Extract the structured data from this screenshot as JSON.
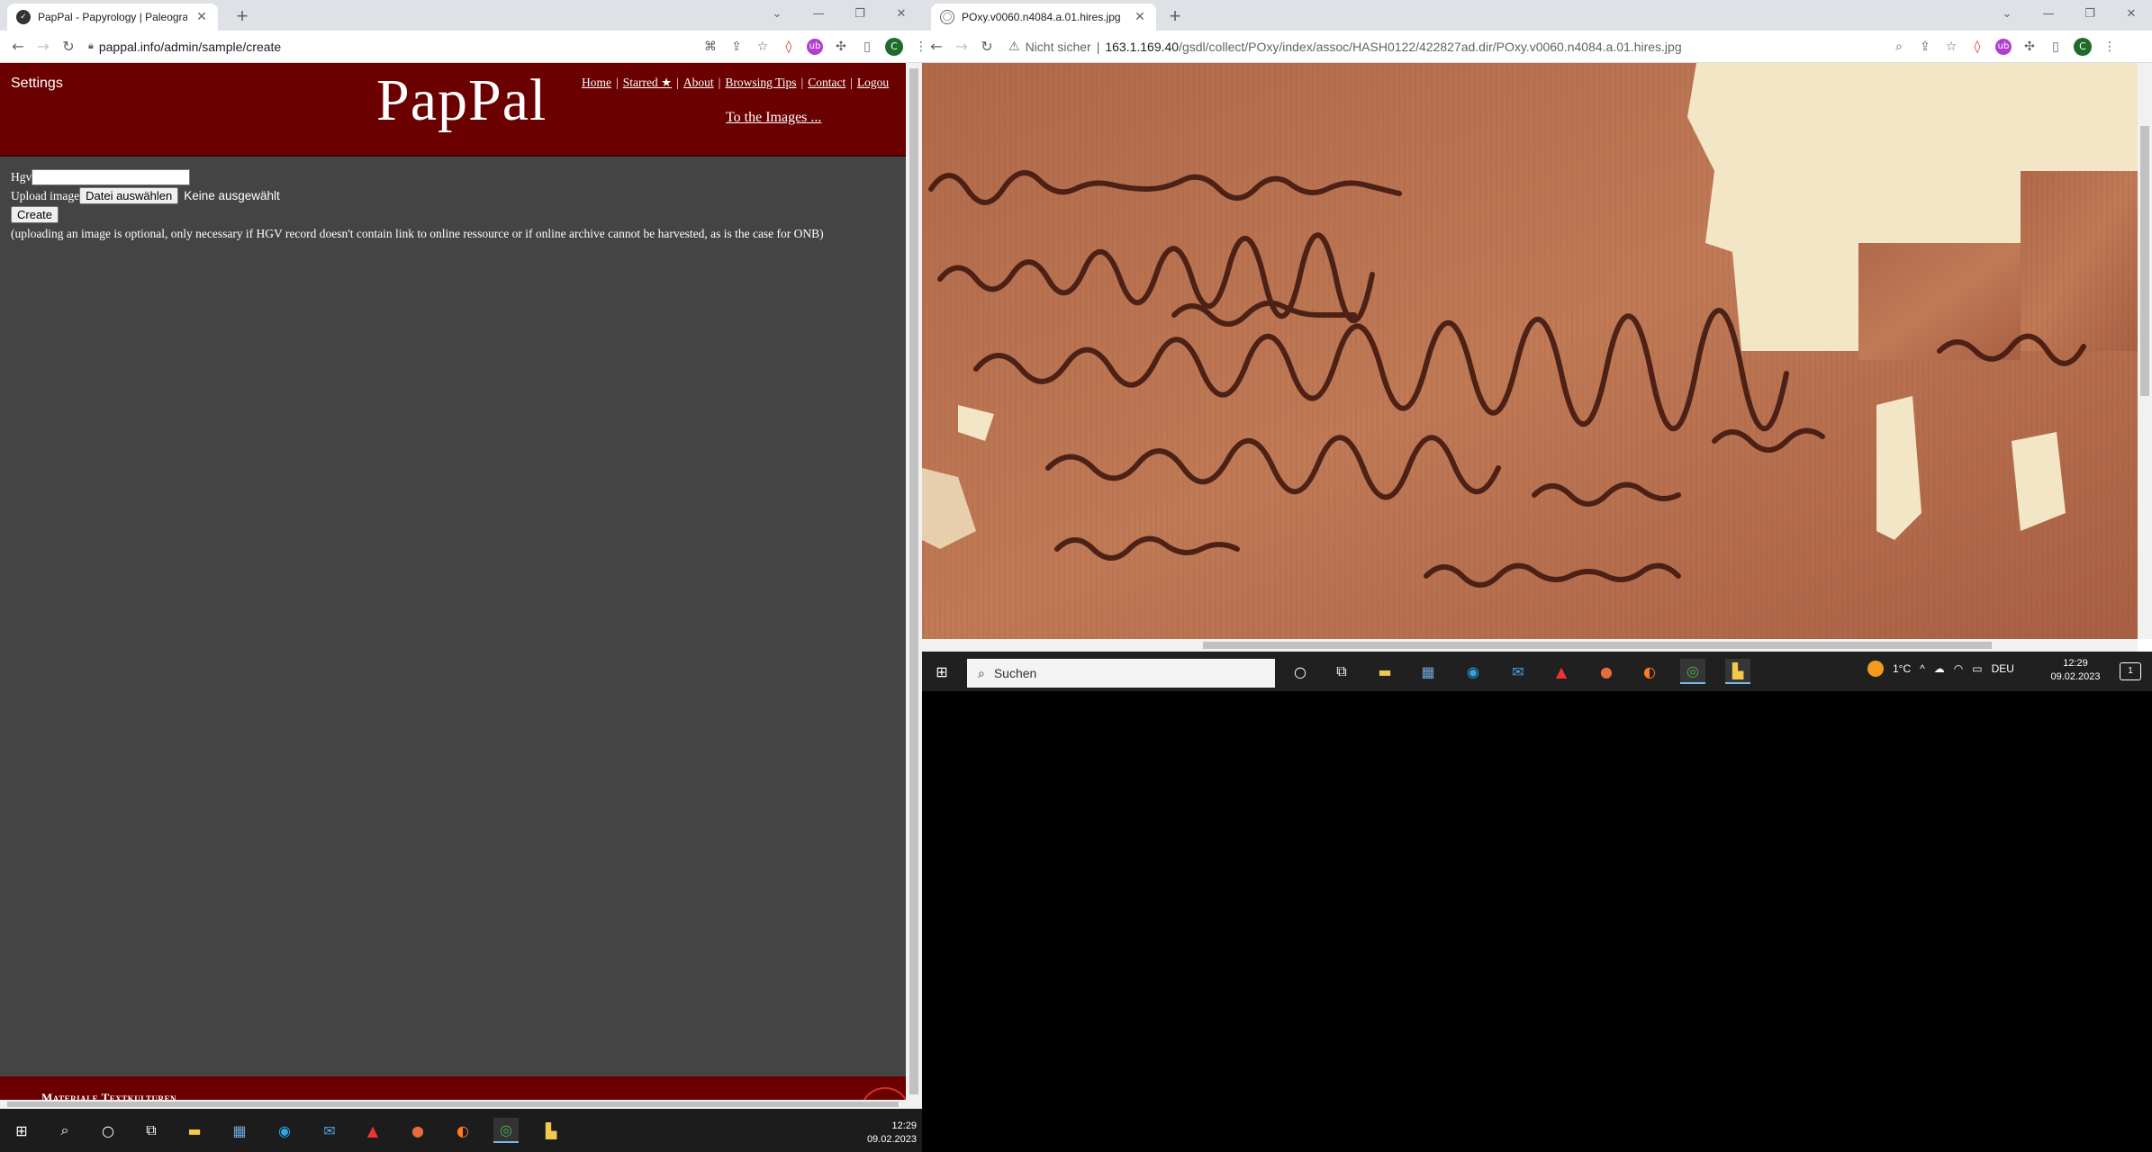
{
  "left_window": {
    "tab_title": "PapPal - Papyrology | Paleograph",
    "url": "pappal.info/admin/sample/create",
    "page": {
      "settings": "Settings",
      "logo": "PapPal",
      "nav": [
        "Home",
        "Starred ★",
        "About",
        "Browsing Tips",
        "Contact",
        "Logou"
      ],
      "to_images": "To the Images ...",
      "form": {
        "hgv_label": "Hgv",
        "hgv_value": "",
        "upload_label": "Upload image",
        "file_button": "Datei auswählen",
        "no_file": "Keine ausgewählt",
        "create_button": "Create",
        "note": "(uploading an image is optional, only necessary if HGV record doesn't contain link to online ressource or if online archive cannot be harvested, as is the case for ONB)"
      },
      "footer_text": "Materiale Textkulturen"
    },
    "taskbar": {
      "time": "12:29",
      "date": "09.02.2023"
    }
  },
  "right_window": {
    "tab_title": "POxy.v0060.n4084.a.01.hires.jpg",
    "security": "Nicht sicher",
    "url_host": "163.1.169.40",
    "url_path": "/gsdl/collect/POxy/index/assoc/HASH0122/422827ad.dir/POxy.v0060.n4084.a.01.hires.jpg",
    "taskbar": {
      "search_placeholder": "Suchen",
      "temperature": "1°C",
      "language": "DEU",
      "time": "12:29",
      "date": "09.02.2023",
      "notifications": "1"
    }
  },
  "colors": {
    "pappal_red": "#6b0000",
    "page_grey": "#444444",
    "papyrus": "#b8704e"
  }
}
